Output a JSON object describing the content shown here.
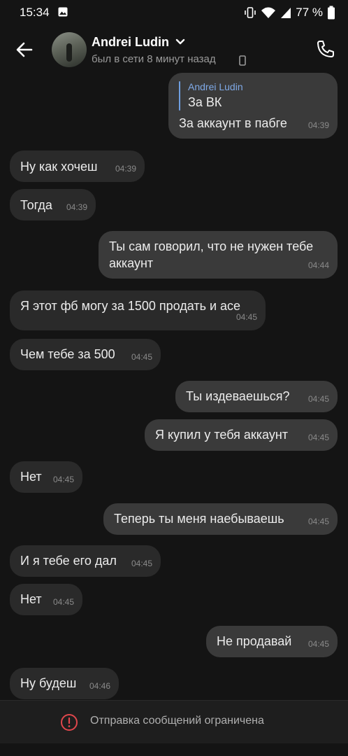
{
  "status": {
    "time": "15:34",
    "battery": "77 %"
  },
  "header": {
    "name": "Andrei Ludin",
    "last_seen": "был в сети 8 минут назад"
  },
  "messages": [
    {
      "dir": "out",
      "reply_to": "Andrei Ludin",
      "reply_text": "За ВК",
      "text": "За аккаунт в пабге",
      "time": "04:39"
    },
    {
      "dir": "in",
      "text": "Ну как хочеш",
      "time": "04:39"
    },
    {
      "dir": "in",
      "text": "Тогда",
      "time": "04:39"
    },
    {
      "dir": "out",
      "text": "Ты сам говорил, что не нужен тебе аккаунт",
      "time": "04:44"
    },
    {
      "dir": "in",
      "text": "Я этот фб могу за 1500 продать и асе",
      "time": "04:45"
    },
    {
      "dir": "in",
      "text": "Чем тебе за 500",
      "time": "04:45"
    },
    {
      "dir": "out",
      "text": "Ты издеваешься?",
      "time": "04:45"
    },
    {
      "dir": "out",
      "text": "Я купил у тебя аккаунт",
      "time": "04:45"
    },
    {
      "dir": "in",
      "text": "Нет",
      "time": "04:45"
    },
    {
      "dir": "out",
      "text": "Теперь ты меня наебываешь",
      "time": "04:45"
    },
    {
      "dir": "in",
      "text": "И я тебе его дал",
      "time": "04:45"
    },
    {
      "dir": "in",
      "text": "Нет",
      "time": "04:45"
    },
    {
      "dir": "out",
      "text": "Не продавай",
      "time": "04:45"
    },
    {
      "dir": "in",
      "text": "Ну будеш",
      "time": "04:46"
    }
  ],
  "footer": {
    "restriction": "Отправка сообщений ограничена"
  }
}
